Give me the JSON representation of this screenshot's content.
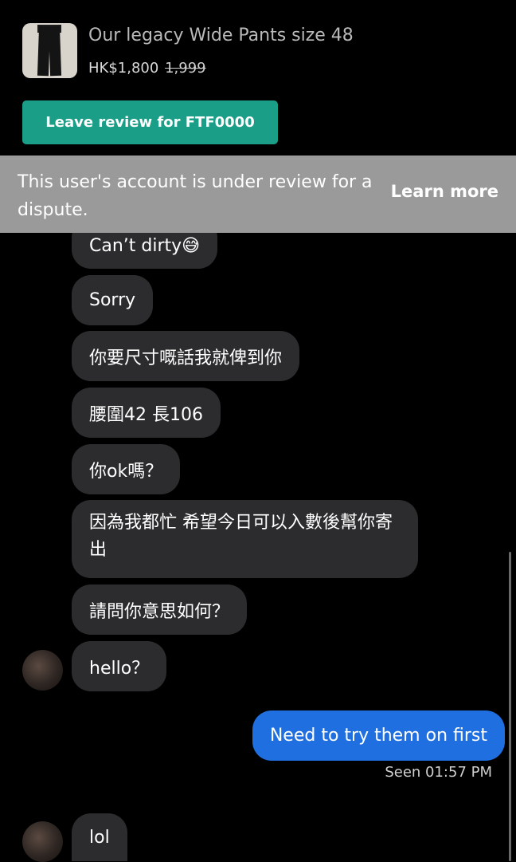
{
  "product": {
    "title": "Our legacy Wide Pants size 48",
    "price": "HK$1,800",
    "original_price": "1,999",
    "review_button": "Leave review for FTF0000"
  },
  "banner": {
    "text": "This user's account is under review for a dispute.",
    "link": "Learn more"
  },
  "messages": [
    {
      "text": "Can’t dirty😅"
    },
    {
      "text": "Sorry"
    },
    {
      "text": "你要尺寸嘅話我就俾到你"
    },
    {
      "text": "腰圍42 長106"
    },
    {
      "text": "你ok嗎？"
    },
    {
      "text": "因為我都忙 希望今日可以入數後幫你寄出"
    },
    {
      "text": "請問你意思如何？"
    },
    {
      "text": "hello？"
    },
    {
      "text": "Need to try them on first"
    },
    {
      "text": "lol"
    }
  ],
  "seen": "Seen 01:57 PM"
}
